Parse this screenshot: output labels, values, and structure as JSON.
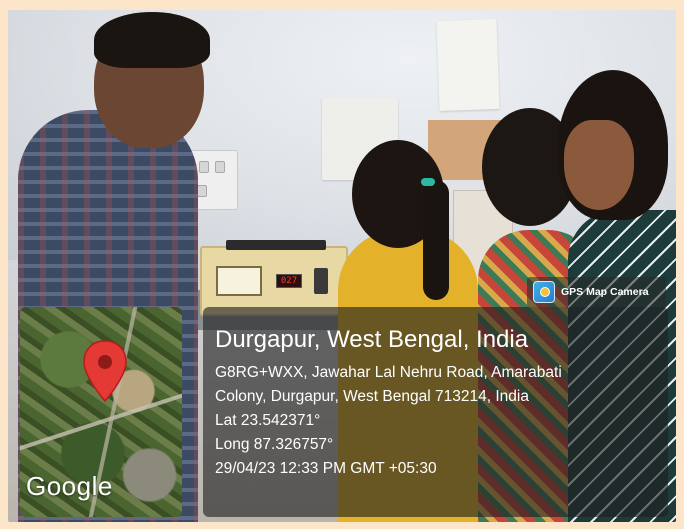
{
  "overlay": {
    "app_badge": {
      "icon": "gps-map-camera-icon",
      "label": "GPS Map Camera"
    },
    "map": {
      "brand": "Google",
      "pin_icon": "map-pin-icon",
      "pin_color": "#e53935"
    },
    "location": {
      "city": "Durgapur, West Bengal, India",
      "address_line1": "G8RG+WXX, Jawahar Lal Nehru Road, Amarabati",
      "address_line2": "Colony, Durgapur, West Bengal 713214, India",
      "lat": "Lat 23.542371°",
      "long": "Long 87.326757°",
      "timestamp": "29/04/23 12:33 PM GMT +05:30"
    }
  },
  "instrument": {
    "display_value": "027"
  },
  "colors": {
    "frame": "#fce5c8",
    "overlay_panel": "rgba(30,30,30,0.62)",
    "text": "#ffffff"
  }
}
